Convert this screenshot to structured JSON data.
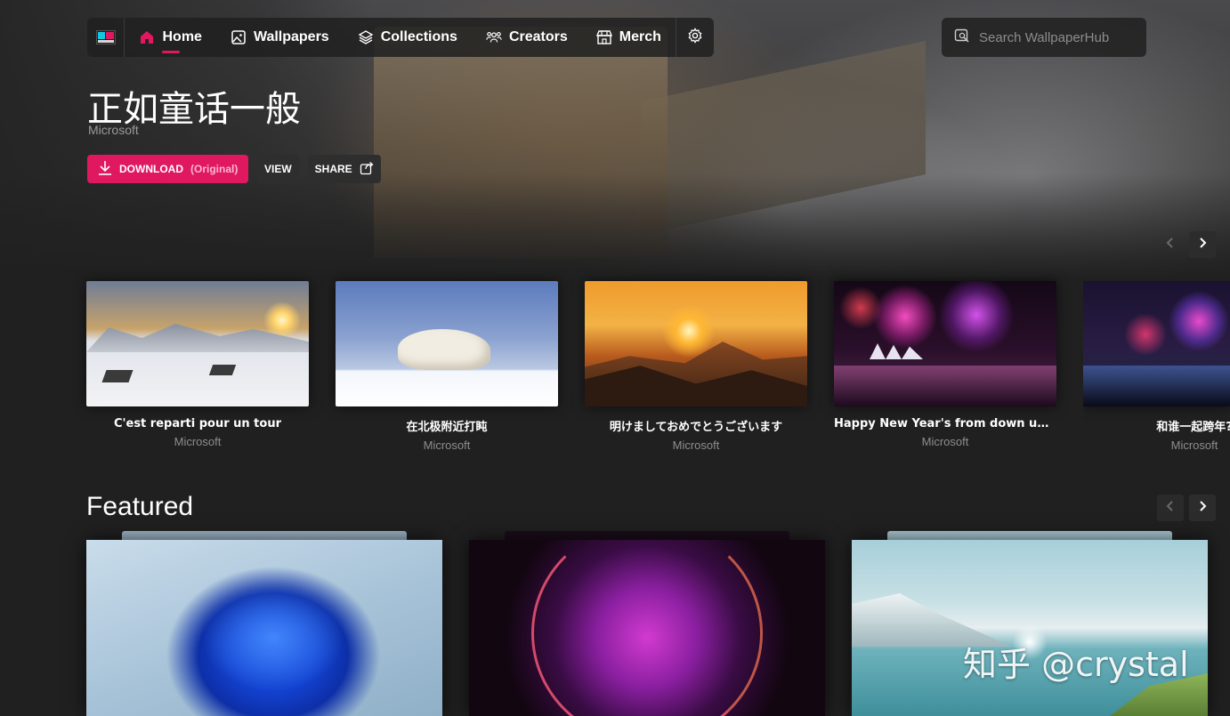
{
  "nav": {
    "items": [
      {
        "label": "Home",
        "icon": "home-icon",
        "active": true
      },
      {
        "label": "Wallpapers",
        "icon": "image-icon",
        "active": false
      },
      {
        "label": "Collections",
        "icon": "layers-icon",
        "active": false
      },
      {
        "label": "Creators",
        "icon": "people-icon",
        "active": false
      },
      {
        "label": "Merch",
        "icon": "store-icon",
        "active": false
      }
    ],
    "settings_icon": "gear-icon",
    "accent": "#e0185f"
  },
  "search": {
    "placeholder": "Search WallpaperHub"
  },
  "hero": {
    "title": "正如童话一般",
    "author": "Microsoft",
    "download_label": "DOWNLOAD",
    "download_sub": "(Original)",
    "view_label": "VIEW",
    "share_label": "SHARE"
  },
  "carousel": [
    {
      "title": "C'est reparti pour un tour",
      "author": "Microsoft"
    },
    {
      "title": "在北极附近打盹",
      "author": "Microsoft"
    },
    {
      "title": "明けましておめでとうございます",
      "author": "Microsoft"
    },
    {
      "title": "Happy New Year's from down un...",
      "author": "Microsoft"
    },
    {
      "title": "和谁一起跨年?",
      "author": "Microsoft"
    }
  ],
  "featured": {
    "title": "Featured"
  },
  "watermark": "知乎 @crystal"
}
